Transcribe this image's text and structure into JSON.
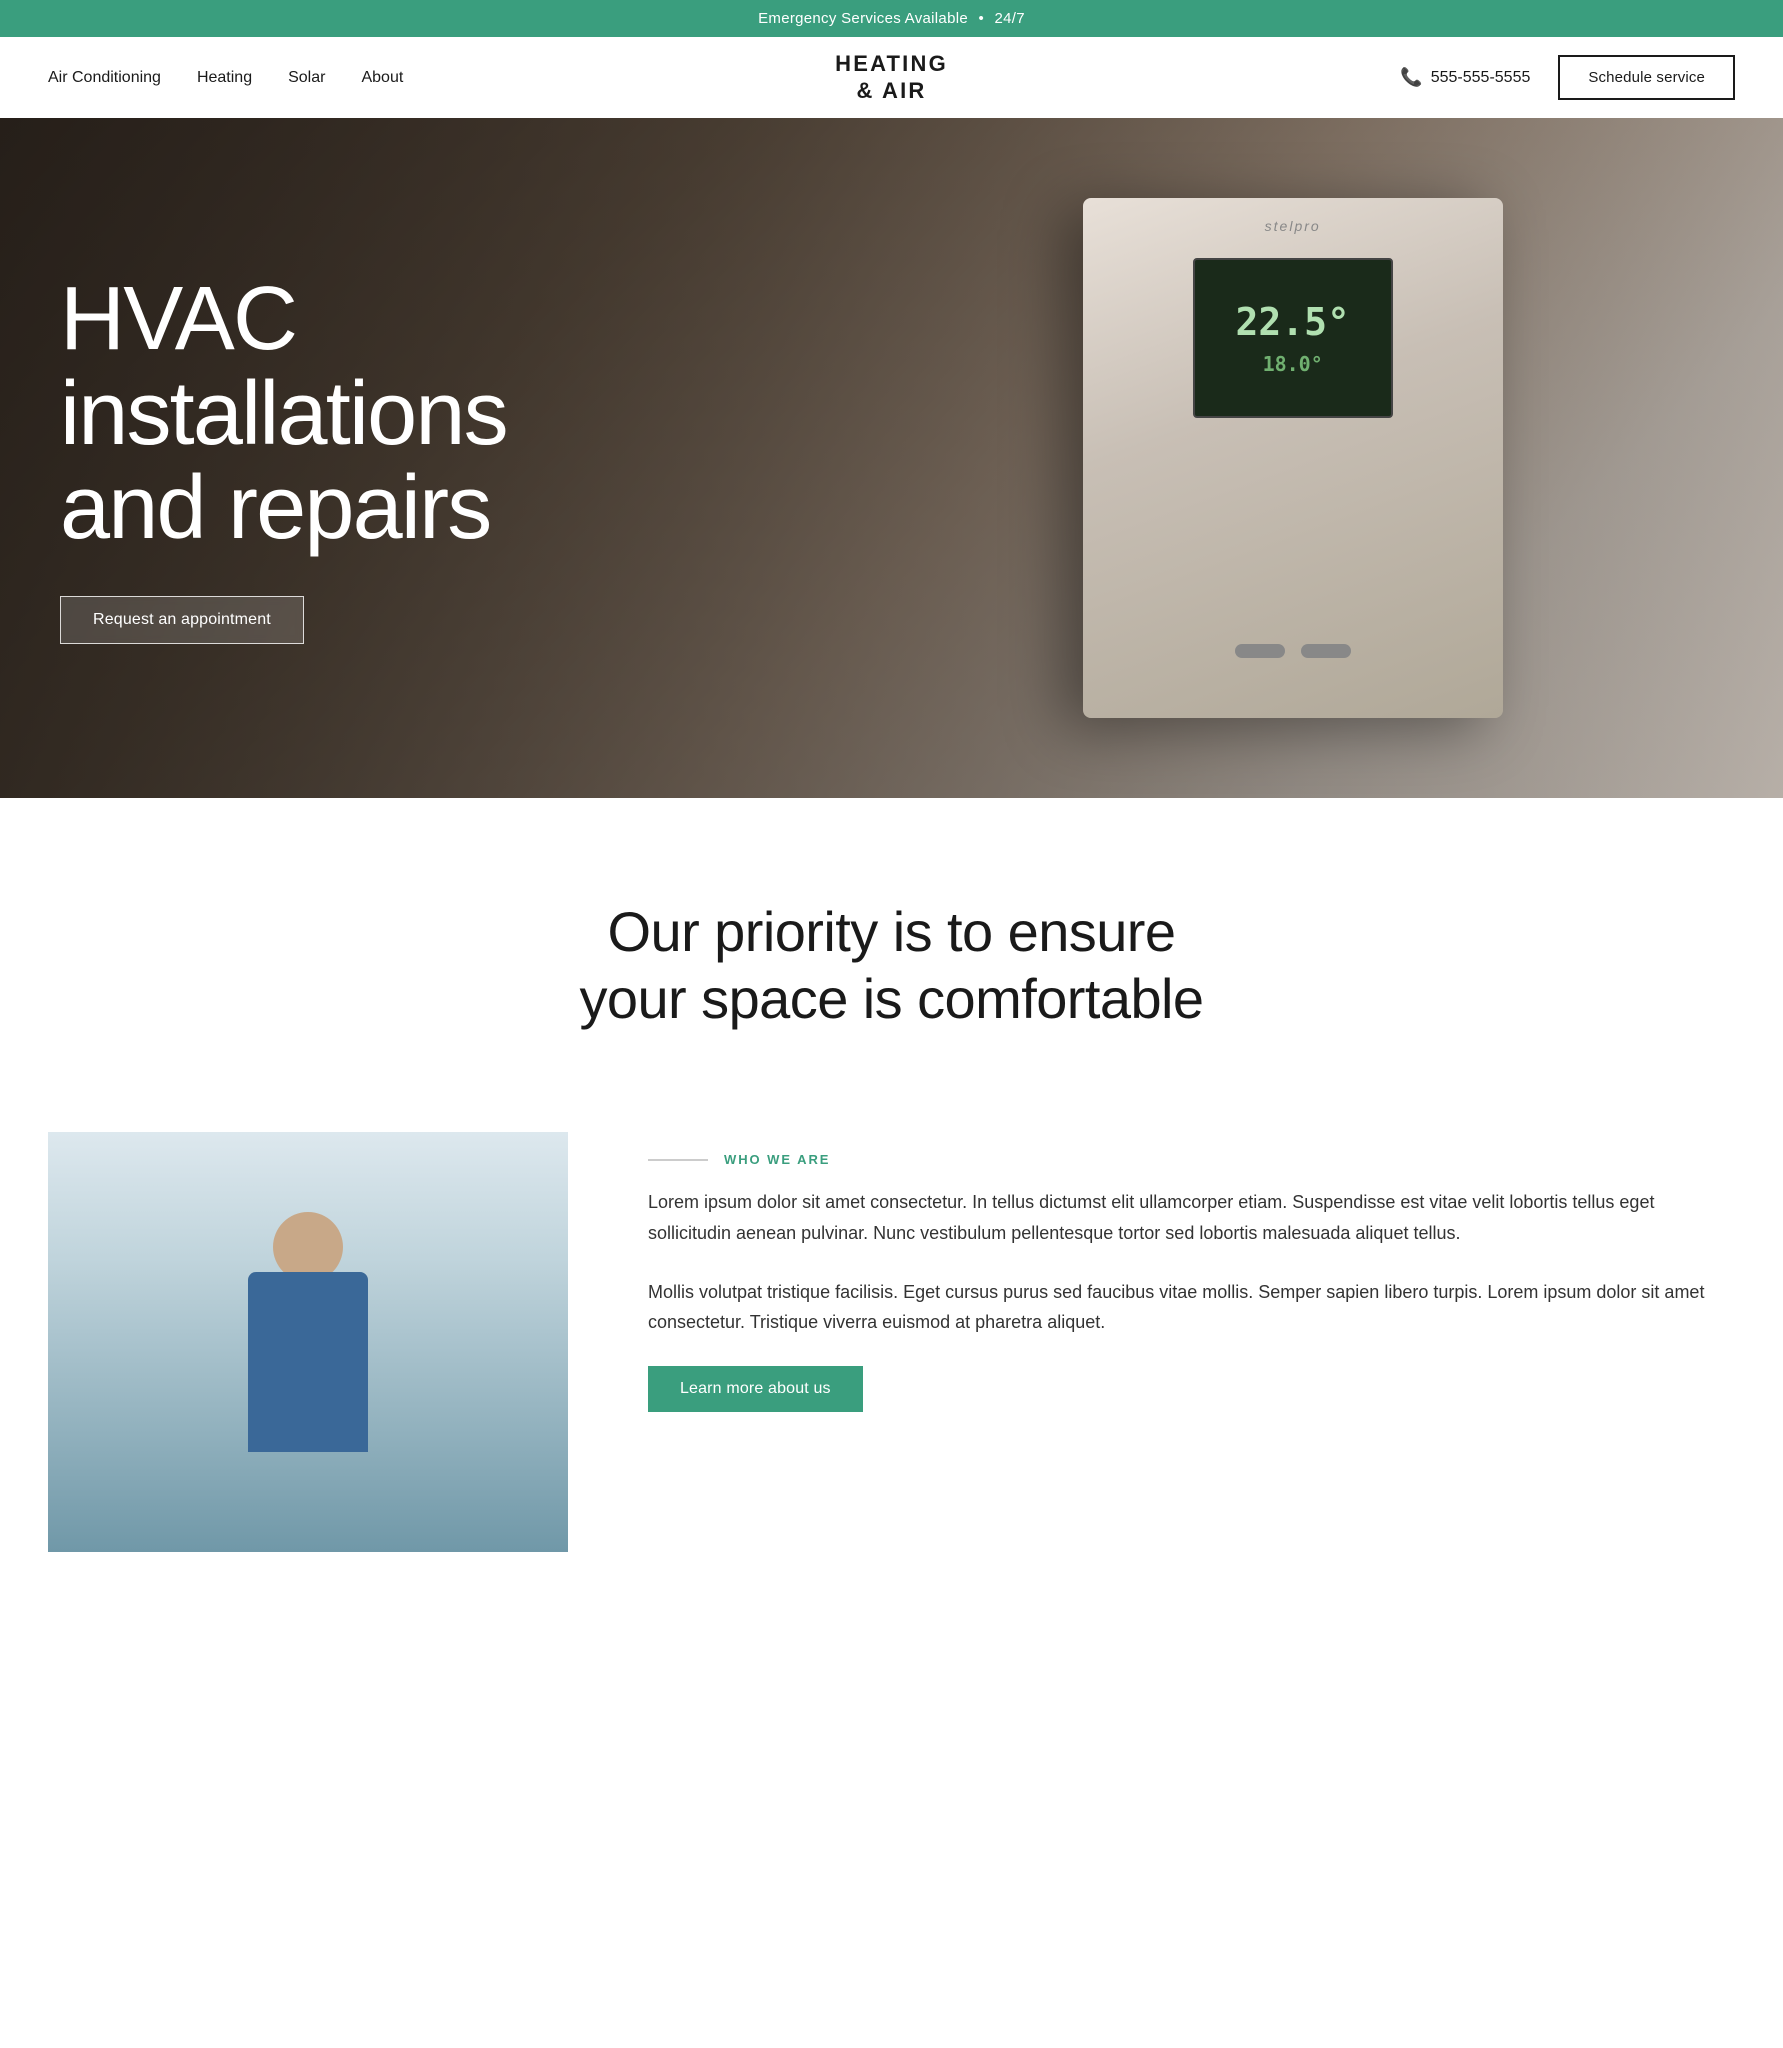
{
  "announcement": {
    "text": "Emergency Services Available",
    "separator": "•",
    "availability": "24/7"
  },
  "nav": {
    "links": [
      {
        "label": "Air Conditioning",
        "href": "#"
      },
      {
        "label": "Heating",
        "href": "#"
      },
      {
        "label": "Solar",
        "href": "#"
      },
      {
        "label": "About",
        "href": "#"
      }
    ],
    "logo_line1": "HEATING",
    "logo_line2": "& AIR",
    "phone": "555-555-5555",
    "schedule_btn": "Schedule service"
  },
  "hero": {
    "title_line1": "HVAC",
    "title_line2": "installations",
    "title_line3": "and repairs",
    "cta": "Request an appointment",
    "thermostat": {
      "brand": "stelpro",
      "temp_main": "22.5°",
      "temp_sub": "18.0°"
    }
  },
  "priority": {
    "heading_line1": "Our priority is to ensure",
    "heading_line2": "your space is comfortable"
  },
  "who_we_are": {
    "section_label": "WHO WE ARE",
    "paragraph1": "Lorem ipsum dolor sit amet consectetur. In tellus dictumst elit ullamcorper etiam. Suspendisse est vitae velit lobortis tellus eget sollicitudin aenean pulvinar. Nunc vestibulum pellentesque tortor sed lobortis malesuada aliquet tellus.",
    "paragraph2": "Mollis volutpat tristique facilisis. Eget cursus purus sed faucibus vitae mollis. Semper sapien libero turpis. Lorem ipsum dolor sit amet consectetur. Tristique viverra euismod at pharetra aliquet.",
    "learn_more_btn": "Learn more about us"
  }
}
